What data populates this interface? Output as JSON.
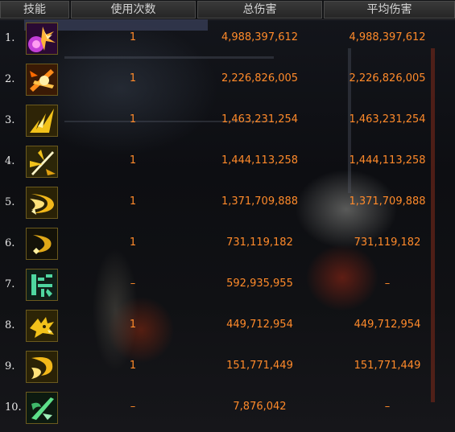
{
  "headers": {
    "skill": "技能",
    "uses": "使用次数",
    "total": "总伤害",
    "average": "平均伤害"
  },
  "colors": {
    "value_text": "#ff8a2a",
    "header_bg": "#2e2e2e",
    "rank_text": "#e8e8e8"
  },
  "rows": [
    {
      "rank": "1.",
      "icon": "purple-burst-skill-icon",
      "uses": "1",
      "total": "4,988,397,612",
      "average": "4,988,397,612"
    },
    {
      "rank": "2.",
      "icon": "orange-slash-burst-skill-icon",
      "uses": "1",
      "total": "2,226,826,005",
      "average": "2,226,826,005"
    },
    {
      "rank": "3.",
      "icon": "gold-spark-skill-icon",
      "uses": "1",
      "total": "1,463,231,254",
      "average": "1,463,231,254"
    },
    {
      "rank": "4.",
      "icon": "sword-flash-skill-icon",
      "uses": "1",
      "total": "1,444,113,258",
      "average": "1,444,113,258"
    },
    {
      "rank": "5.",
      "icon": "crescent-wave-skill-icon",
      "uses": "1",
      "total": "1,371,709,888",
      "average": "1,371,709,888"
    },
    {
      "rank": "6.",
      "icon": "crescent-spark-skill-icon",
      "uses": "1",
      "total": "731,119,182",
      "average": "731,119,182"
    },
    {
      "rank": "7.",
      "icon": "green-glyph-skill-icon",
      "uses": "–",
      "total": "592,935,955",
      "average": "–"
    },
    {
      "rank": "8.",
      "icon": "dragon-head-skill-icon",
      "uses": "1",
      "total": "449,712,954",
      "average": "449,712,954"
    },
    {
      "rank": "9.",
      "icon": "swirl-claw-skill-icon",
      "uses": "1",
      "total": "151,771,449",
      "average": "151,771,449"
    },
    {
      "rank": "10.",
      "icon": "green-blade-skill-icon",
      "uses": "–",
      "total": "7,876,042",
      "average": "–"
    }
  ]
}
